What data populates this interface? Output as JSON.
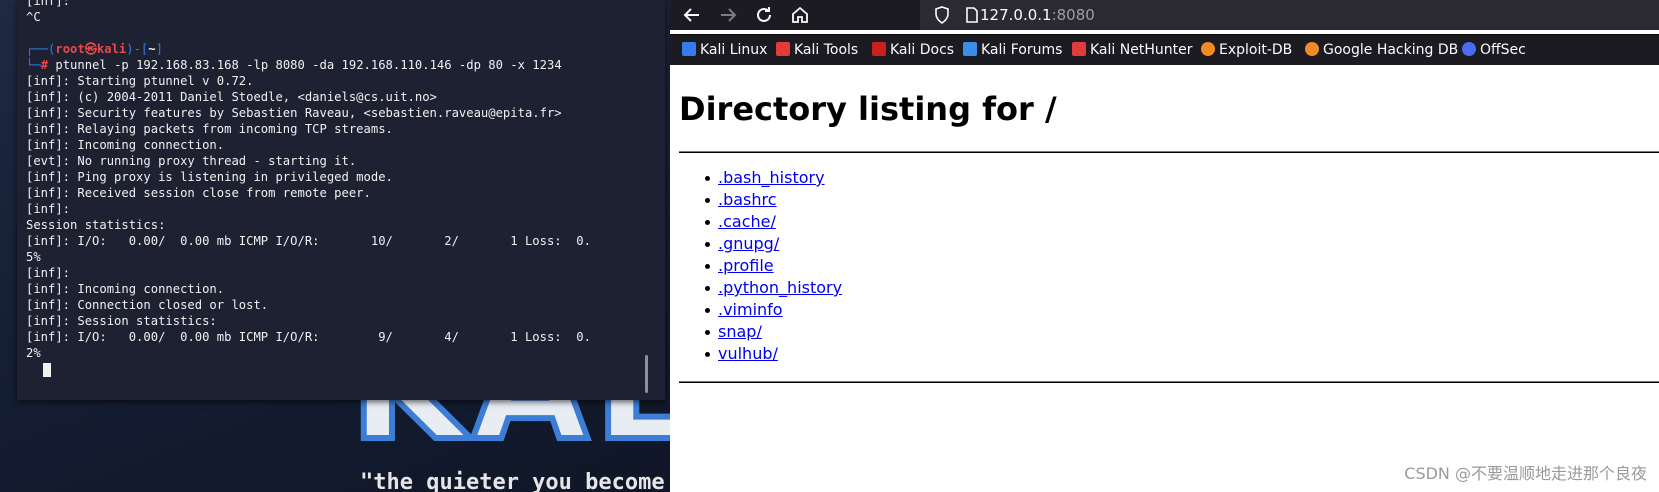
{
  "terminal": {
    "line_partial": "[inf]:",
    "line_ctrl_c": "^C",
    "prompt_open": "┌──(",
    "prompt_user": "root㉿kali",
    "prompt_mid": ")-[",
    "prompt_path": "~",
    "prompt_close": "]",
    "prompt_hash_prefix": "└─",
    "prompt_hash": "#",
    "command": " ptunnel -p 192.168.83.168 -lp 8080 -da 192.168.110.146 -dp 80 -x 1234",
    "output": [
      "[inf]: Starting ptunnel v 0.72.",
      "[inf]: (c) 2004-2011 Daniel Stoedle, <daniels@cs.uit.no>",
      "[inf]: Security features by Sebastien Raveau, <sebastien.raveau@epita.fr>",
      "[inf]: Relaying packets from incoming TCP streams.",
      "[inf]: Incoming connection.",
      "[evt]: No running proxy thread - starting it.",
      "[inf]: Ping proxy is listening in privileged mode.",
      "[inf]: Received session close from remote peer.",
      "[inf]:",
      "Session statistics:",
      "[inf]: I/O:   0.00/  0.00 mb ICMP I/O/R:       10/       2/       1 Loss:  0.",
      "5%",
      "[inf]:",
      "[inf]: Incoming connection.",
      "[inf]: Connection closed or lost.",
      "[inf]: Session statistics:",
      "[inf]: I/O:   0.00/  0.00 mb ICMP I/O/R:        9/       4/       1 Loss:  0.",
      "2%"
    ]
  },
  "desktop": {
    "logo_text": "KALI",
    "quote": "\"the quieter you become"
  },
  "browser": {
    "url_host": "127.0.0.1",
    "url_port": ":8080",
    "bookmarks": [
      {
        "label": "Kali Linux",
        "icon": "kali-icon",
        "color": "#367bf0"
      },
      {
        "label": "Kali Tools",
        "icon": "kali-tools-icon",
        "color": "#e53a3a"
      },
      {
        "label": "Kali Docs",
        "icon": "kali-docs-icon",
        "color": "#cc2020"
      },
      {
        "label": "Kali Forums",
        "icon": "kali-forums-icon",
        "color": "#3a8ee6"
      },
      {
        "label": "Kali NetHunter",
        "icon": "nethunter-icon",
        "color": "#e23b3b"
      },
      {
        "label": "Exploit-DB",
        "icon": "exploit-db-icon",
        "color": "#f08a24"
      },
      {
        "label": "Google Hacking DB",
        "icon": "ghdb-icon",
        "color": "#f08a24"
      },
      {
        "label": "OffSec",
        "icon": "offsec-icon",
        "color": "#4a6cf0"
      }
    ],
    "page": {
      "title": "Directory listing for /",
      "files": [
        ".bash_history",
        ".bashrc",
        ".cache/",
        ".gnupg/",
        ".profile",
        ".python_history",
        ".viminfo",
        "snap/",
        "vulhub/"
      ]
    }
  },
  "watermark": "CSDN @不要温顺地走进那个良夜"
}
